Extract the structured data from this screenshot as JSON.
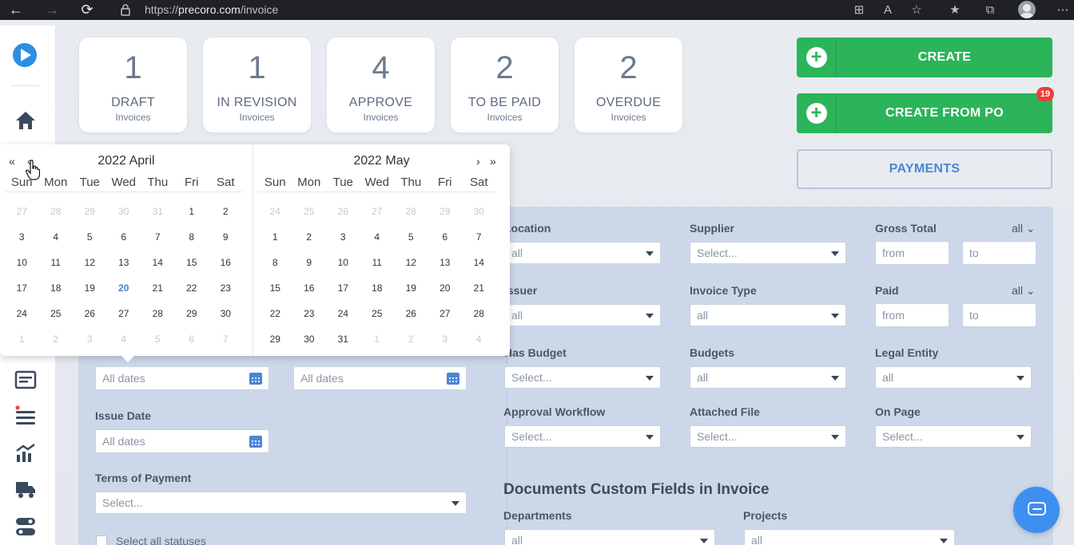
{
  "browser": {
    "url_prefix": "https://",
    "url_domain": "precoro.com",
    "url_path": "/invoice"
  },
  "stats": [
    {
      "count": "1",
      "label": "DRAFT",
      "sub": "Invoices"
    },
    {
      "count": "1",
      "label": "IN REVISION",
      "sub": "Invoices"
    },
    {
      "count": "4",
      "label": "APPROVE",
      "sub": "Invoices"
    },
    {
      "count": "2",
      "label": "TO BE PAID",
      "sub": "Invoices"
    },
    {
      "count": "2",
      "label": "OVERDUE",
      "sub": "Invoices"
    }
  ],
  "actions": {
    "create": "CREATE",
    "create_from_po": "CREATE FROM PO",
    "create_from_po_badge": "19",
    "payments": "PAYMENTS"
  },
  "calendar": {
    "prev_year": "«",
    "prev_month": "‹",
    "next_month": "›",
    "next_year": "»",
    "weekdays": [
      "Sun",
      "Mon",
      "Tue",
      "Wed",
      "Thu",
      "Fri",
      "Sat"
    ],
    "left": {
      "title": "2022 April",
      "weeks": [
        [
          "27",
          "28",
          "29",
          "30",
          "31",
          "1",
          "2"
        ],
        [
          "3",
          "4",
          "5",
          "6",
          "7",
          "8",
          "9"
        ],
        [
          "10",
          "11",
          "12",
          "13",
          "14",
          "15",
          "16"
        ],
        [
          "17",
          "18",
          "19",
          "20",
          "21",
          "22",
          "23"
        ],
        [
          "24",
          "25",
          "26",
          "27",
          "28",
          "29",
          "30"
        ],
        [
          "1",
          "2",
          "3",
          "4",
          "5",
          "6",
          "7"
        ]
      ]
    },
    "right": {
      "title": "2022 May",
      "weeks": [
        [
          "24",
          "25",
          "26",
          "27",
          "28",
          "29",
          "30"
        ],
        [
          "1",
          "2",
          "3",
          "4",
          "5",
          "6",
          "7"
        ],
        [
          "8",
          "9",
          "10",
          "11",
          "12",
          "13",
          "14"
        ],
        [
          "15",
          "16",
          "17",
          "18",
          "19",
          "20",
          "21"
        ],
        [
          "22",
          "23",
          "24",
          "25",
          "26",
          "27",
          "28"
        ],
        [
          "29",
          "30",
          "31",
          "1",
          "2",
          "3",
          "4"
        ]
      ]
    },
    "today": "20"
  },
  "filters": {
    "date_field_1_placeholder": "All dates",
    "date_field_2_placeholder": "All dates",
    "issue_date_label": "Issue Date",
    "issue_date_placeholder": "All dates",
    "terms_label": "Terms of Payment",
    "terms_value": "Select...",
    "select_all_statuses": "Select all statuses",
    "location_label": "Location",
    "location_value": "all",
    "supplier_label": "Supplier",
    "supplier_value": "Select...",
    "gross_total_label": "Gross Total",
    "gross_total_mode": "all",
    "gross_from": "from",
    "gross_to": "to",
    "issuer_label": "Issuer",
    "issuer_value": "all",
    "invoice_type_label": "Invoice Type",
    "invoice_type_value": "all",
    "paid_label": "Paid",
    "paid_mode": "all",
    "paid_from": "from",
    "paid_to": "to",
    "has_budget_label": "Has Budget",
    "has_budget_value": "Select...",
    "budgets_label": "Budgets",
    "budgets_value": "all",
    "legal_entity_label": "Legal Entity",
    "legal_entity_value": "all",
    "approval_workflow_label": "Approval Workflow",
    "approval_workflow_value": "Select...",
    "attached_file_label": "Attached File",
    "attached_file_value": "Select...",
    "on_page_label": "On Page",
    "on_page_value": "Select...",
    "custom_fields_title": "Documents Custom Fields in Invoice",
    "departments_label": "Departments",
    "departments_value": "all",
    "projects_label": "Projects",
    "projects_value": "all"
  },
  "colors": {
    "green": "#2bb45a",
    "blue_accent": "#4a86d6",
    "badge_red": "#ef3b3b"
  }
}
